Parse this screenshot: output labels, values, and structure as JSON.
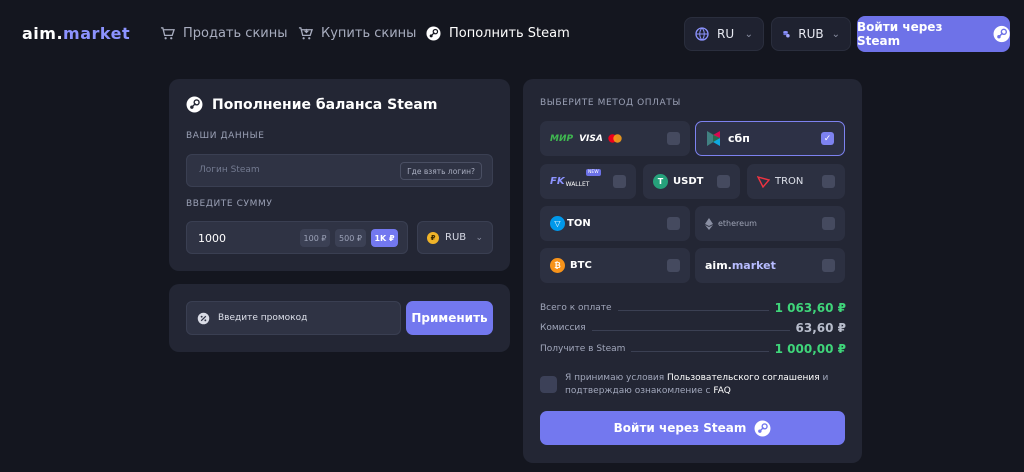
{
  "header": {
    "logo_main": "aim.",
    "logo_accent": "market",
    "nav": [
      {
        "label": "Продать скины",
        "icon": "cart-icon"
      },
      {
        "label": "Купить скины",
        "icon": "cart-down-icon"
      },
      {
        "label": "Пополнить Steam",
        "icon": "steam-icon"
      }
    ],
    "language": "RU",
    "currency": "RUB",
    "login_label": "Войти через Steam"
  },
  "topup": {
    "title": "Пополнение баланса Steam",
    "your_data_label": "ВАШИ ДАННЫЕ",
    "login_placeholder": "Логин Steam",
    "where_login": "Где взять логин?",
    "amount_label": "ВВЕДИТЕ СУММУ",
    "amount_value": "1000",
    "presets": [
      "100 ₽",
      "500 ₽",
      "1K ₽"
    ],
    "currency": "RUB",
    "currency_symbol": "₽"
  },
  "promo": {
    "placeholder": "Введите промокод",
    "apply_label": "Применить"
  },
  "payment": {
    "title": "ВЫБЕРИТЕ МЕТОД ОПЛАТЫ",
    "methods": {
      "cards": {
        "mir": "МИР",
        "visa": "VISA"
      },
      "sbp": "сбп",
      "fk": "FK",
      "fk_wallet": "WALLET",
      "fk_badge": "NEW",
      "usdt": "USDT",
      "tron": "TRON",
      "ton": "TON",
      "ethereum": "ethereum",
      "btc": "BTC",
      "aim_main": "aim.",
      "aim_accent": "market",
      "selected": "sbp"
    },
    "summary": [
      {
        "label": "Всего к оплате",
        "value": "1 063,60 ₽",
        "color": "#3fd67a"
      },
      {
        "label": "Комиссия",
        "value": "63,60 ₽",
        "color": "#b8bdcc"
      },
      {
        "label": "Получите в Steam",
        "value": "1 000,00 ₽",
        "color": "#3fd67a"
      }
    ],
    "agree_prefix": "Я принимаю условия ",
    "agree_link1": "Пользовательского соглашения",
    "agree_mid": " и",
    "agree_line2": "подтверждаю ознакомление с ",
    "agree_link2": "FAQ",
    "login_label": "Войти через Steam"
  },
  "colors": {
    "accent": "#7378ef",
    "green": "#3fd67a",
    "background": "#14161f",
    "panel": "#232634"
  }
}
